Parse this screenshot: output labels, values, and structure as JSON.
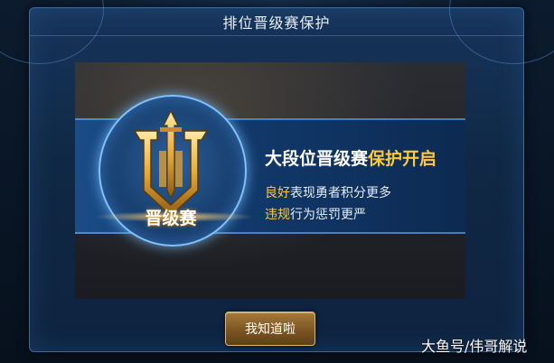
{
  "dialog": {
    "title": "排位晋级赛保护",
    "banner": {
      "emblem_label": "晋级赛",
      "headline_white": "大段位晋级赛",
      "headline_highlight": "保护开启",
      "line1_highlight": "良好",
      "line1_rest": "表现勇者积分更多",
      "line2_highlight": "违规",
      "line2_rest": "行为惩罚更严"
    },
    "confirm_button": "我知道啦"
  },
  "watermark": "大鱼号/伟哥解说",
  "colors": {
    "highlight": "#ffc83a",
    "dialog_bg": "#102845",
    "button_gold": "#7c5522"
  }
}
